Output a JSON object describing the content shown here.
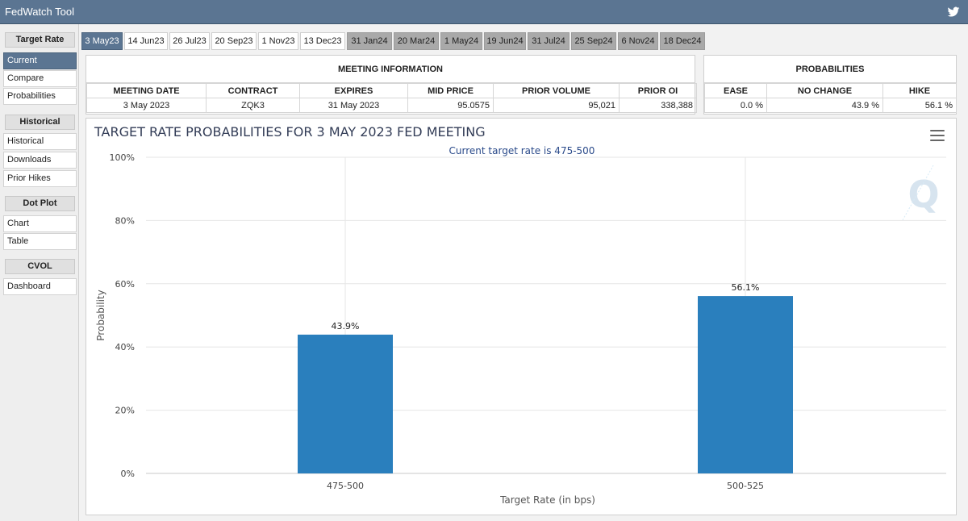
{
  "app": {
    "title": "FedWatch Tool",
    "twitter_icon": "twitter-icon"
  },
  "sidebar": {
    "sections": [
      {
        "header": "Target Rate",
        "items": [
          "Current",
          "Compare",
          "Probabilities"
        ]
      },
      {
        "header": "Historical",
        "items": [
          "Historical",
          "Downloads",
          "Prior Hikes"
        ]
      },
      {
        "header": "Dot Plot",
        "items": [
          "Chart",
          "Table"
        ]
      },
      {
        "header": "CVOL",
        "items": [
          "Dashboard"
        ]
      }
    ],
    "active_item": "Current"
  },
  "tabs": [
    {
      "label": "3 May23",
      "state": "active"
    },
    {
      "label": "14 Jun23",
      "state": "normal"
    },
    {
      "label": "26 Jul23",
      "state": "normal"
    },
    {
      "label": "20 Sep23",
      "state": "normal"
    },
    {
      "label": "1 Nov23",
      "state": "normal"
    },
    {
      "label": "13 Dec23",
      "state": "normal"
    },
    {
      "label": "31 Jan24",
      "state": "dim"
    },
    {
      "label": "20 Mar24",
      "state": "dim"
    },
    {
      "label": "1 May24",
      "state": "dim"
    },
    {
      "label": "19 Jun24",
      "state": "dim"
    },
    {
      "label": "31 Jul24",
      "state": "dim"
    },
    {
      "label": "25 Sep24",
      "state": "dim"
    },
    {
      "label": "6 Nov24",
      "state": "dim"
    },
    {
      "label": "18 Dec24",
      "state": "dim"
    }
  ],
  "meeting_info": {
    "caption": "MEETING INFORMATION",
    "headers": [
      "MEETING DATE",
      "CONTRACT",
      "EXPIRES",
      "MID PRICE",
      "PRIOR VOLUME",
      "PRIOR OI"
    ],
    "row": [
      "3 May 2023",
      "ZQK3",
      "31 May 2023",
      "95.0575",
      "95,021",
      "338,388"
    ]
  },
  "probabilities": {
    "caption": "PROBABILITIES",
    "headers": [
      "EASE",
      "NO CHANGE",
      "HIKE"
    ],
    "row": [
      "0.0 %",
      "43.9 %",
      "56.1 %"
    ]
  },
  "chart": {
    "title": "TARGET RATE PROBABILITIES FOR 3 MAY 2023 FED MEETING",
    "subtitle": "Current target rate is 475-500",
    "menu_icon": "hamburger-menu-icon",
    "watermark": "Q",
    "colors": {
      "bar": "#2a7fbd",
      "title": "#333d57",
      "subtitle": "#2a4a8a"
    }
  },
  "chart_data": {
    "type": "bar",
    "categories": [
      "475-500",
      "500-525"
    ],
    "values": [
      43.9,
      56.1
    ],
    "data_labels": [
      "43.9%",
      "56.1%"
    ],
    "title": "TARGET RATE PROBABILITIES FOR 3 MAY 2023 FED MEETING",
    "subtitle": "Current target rate is 475-500",
    "xlabel": "Target Rate (in bps)",
    "ylabel": "Probability",
    "ylim": [
      0,
      100
    ],
    "yticks": [
      "0%",
      "20%",
      "40%",
      "60%",
      "80%",
      "100%"
    ],
    "grid": true
  }
}
